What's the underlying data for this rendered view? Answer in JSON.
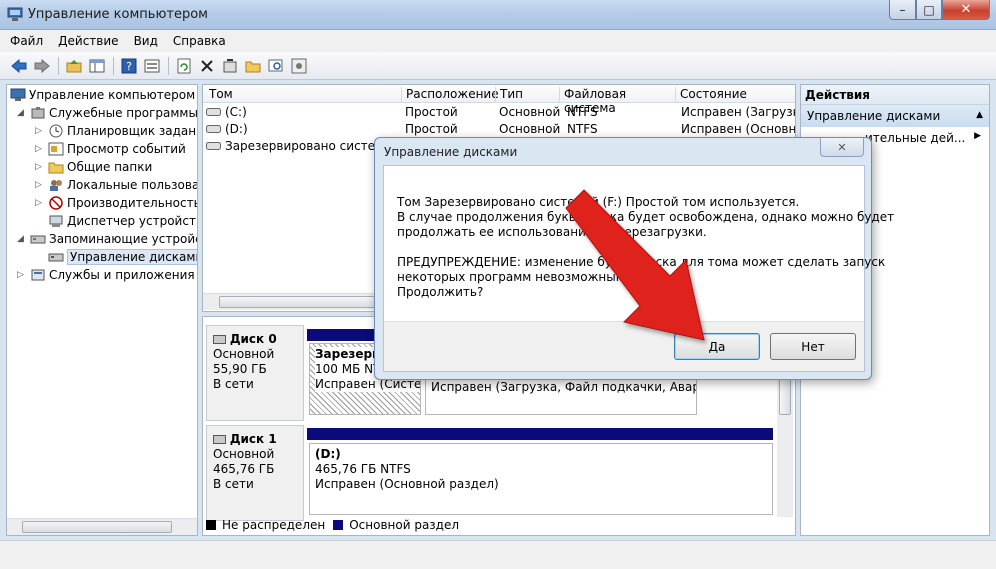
{
  "window": {
    "title": "Управление компьютером",
    "min": "–",
    "max": "□",
    "close": "✕"
  },
  "menu": [
    "Файл",
    "Действие",
    "Вид",
    "Справка"
  ],
  "toolbar": [
    "back-icon",
    "forward-icon",
    "up-folder-icon",
    "show-hide-tree-icon",
    "help-icon",
    "properties-icon",
    "refresh-icon",
    "delete-icon",
    "wizard-icon",
    "open-folder-icon",
    "search-icon",
    "settings-icon"
  ],
  "tree": {
    "items": [
      {
        "label": "Управление компьютером (л",
        "level": 0,
        "expander": ""
      },
      {
        "label": "Служебные программы",
        "level": 1,
        "expander": "◢"
      },
      {
        "label": "Планировщик заданий",
        "level": 2,
        "expander": "▷"
      },
      {
        "label": "Просмотр событий",
        "level": 2,
        "expander": "▷"
      },
      {
        "label": "Общие папки",
        "level": 2,
        "expander": "▷"
      },
      {
        "label": "Локальные пользовате",
        "level": 2,
        "expander": "▷"
      },
      {
        "label": "Производительность",
        "level": 2,
        "expander": "▷"
      },
      {
        "label": "Диспетчер устройств",
        "level": 2,
        "expander": ""
      },
      {
        "label": "Запоминающие устройст",
        "level": 1,
        "expander": "◢"
      },
      {
        "label": "Управление дисками",
        "level": 2,
        "expander": "",
        "selected": true
      },
      {
        "label": "Службы и приложения",
        "level": 1,
        "expander": "▷"
      }
    ]
  },
  "volumes": {
    "columns": [
      "Том",
      "Расположение",
      "Тип",
      "Файловая система",
      "Состояние"
    ],
    "rows": [
      [
        "(C:)",
        "Простой",
        "Основной",
        "NTFS",
        "Исправен (Загрузка,"
      ],
      [
        "(D:)",
        "Простой",
        "Основной",
        "NTFS",
        "Исправен (Основно"
      ],
      [
        "Зарезервировано системой",
        "",
        "",
        "",
        ""
      ]
    ]
  },
  "disks": [
    {
      "name": "Диск 0",
      "type": "Основной",
      "size": "55,90 ГБ",
      "status": "В сети",
      "partitions": [
        {
          "title": "Зарезерв",
          "detail": "100 МБ NTFS",
          "state": "Исправен (Систем"
        },
        {
          "title": "",
          "detail": "",
          "state": "Исправен (Загрузка, Файл подкачки, Аварийнь"
        }
      ]
    },
    {
      "name": "Диск 1",
      "type": "Основной",
      "size": "465,76 ГБ",
      "status": "В сети",
      "partitions": [
        {
          "title": "(D:)",
          "detail": "465,76 ГБ NTFS",
          "state": "Исправен (Основной раздел)"
        }
      ]
    }
  ],
  "legend": [
    {
      "label": "Не распределен",
      "color": "#000000"
    },
    {
      "label": "Основной раздел",
      "color": "#0a0a7a"
    }
  ],
  "actions": {
    "header": "Действия",
    "section": "Управление дисками",
    "more": "ительные дей..."
  },
  "dialog": {
    "title": "Управление дисками",
    "close": "✕",
    "lines": [
      "Том Зарезервировано системой (F:) Простой том используется.",
      " В случае продолжения буква диска будет освобождена, однако можно будет",
      "продолжать ее использование до перезагрузки.",
      "ПРЕДУПРЕЖДЕНИЕ: изменение буквы диска для тома может сделать запуск",
      "некоторых программ невозможным.",
      "Продолжить?"
    ],
    "yes": "Да",
    "no": "Нет"
  },
  "accent": {
    "arrow": "#e0201a",
    "partition": "#0a0a7a"
  }
}
